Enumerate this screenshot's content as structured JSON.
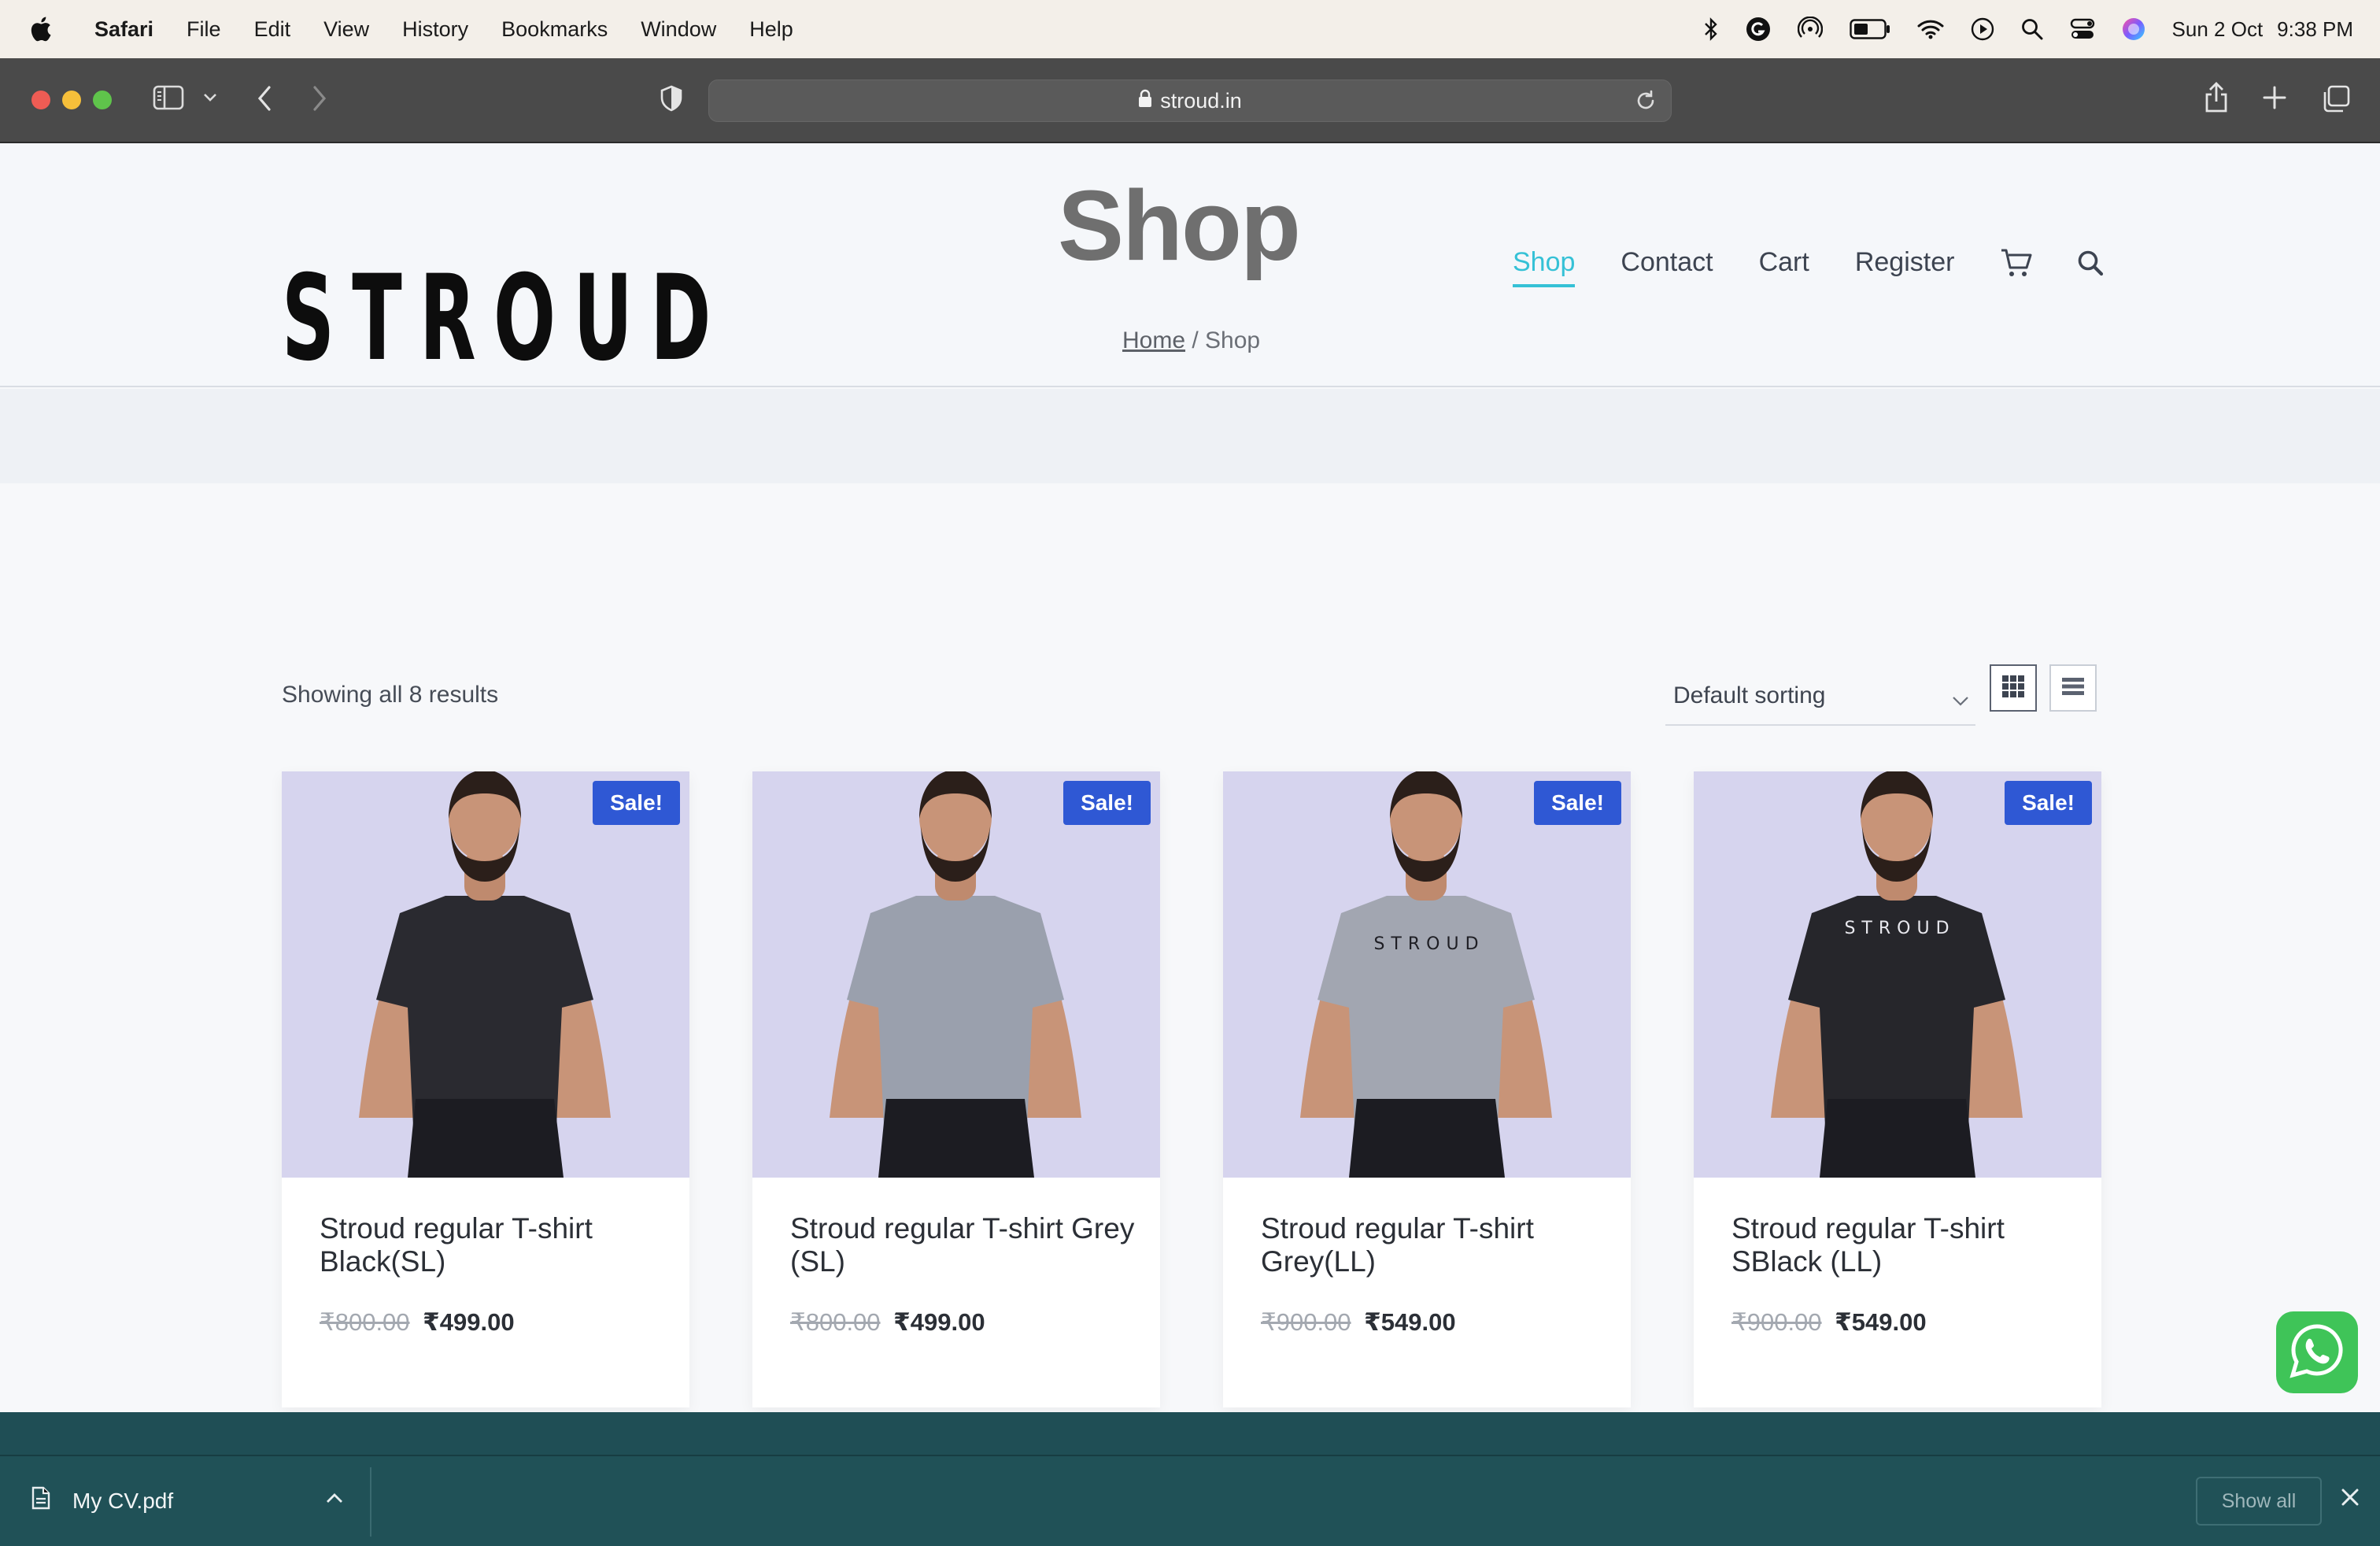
{
  "menubar": {
    "app": "Safari",
    "items": [
      "File",
      "Edit",
      "View",
      "History",
      "Bookmarks",
      "Window",
      "Help"
    ],
    "date": "Sun 2 Oct",
    "time": "9:38 PM"
  },
  "browser": {
    "url": "stroud.in"
  },
  "site": {
    "logo": "STROUD",
    "page_title": "Shop",
    "breadcrumb_home": "Home",
    "breadcrumb_sep": " / ",
    "breadcrumb_current": "Shop",
    "nav": [
      "Shop",
      "Contact",
      "Cart",
      "Register"
    ],
    "results": "Showing all 8 results",
    "sorting": "Default sorting"
  },
  "products": [
    {
      "badge": "Sale!",
      "name": "Stroud regular T-shirt Black(SL)",
      "old_price": "₹800.00",
      "price": "₹499.00",
      "shirt_color": "#2a2a30",
      "chest_text": ""
    },
    {
      "badge": "Sale!",
      "name": "Stroud regular T-shirt Grey (SL)",
      "old_price": "₹800.00",
      "price": "₹499.00",
      "shirt_color": "#9aa0ad",
      "chest_text": ""
    },
    {
      "badge": "Sale!",
      "name": "Stroud regular T-shirt Grey(LL)",
      "old_price": "₹900.00",
      "price": "₹549.00",
      "shirt_color": "#a2a6b1",
      "chest_text": "STROUD"
    },
    {
      "badge": "Sale!",
      "name": "Stroud regular T-shirt SBlack (LL)",
      "old_price": "₹900.00",
      "price": "₹549.00",
      "shirt_color": "#26262b",
      "chest_text": "STROUD"
    }
  ],
  "downloads": {
    "file": "My CV.pdf",
    "show_all": "Show all"
  }
}
